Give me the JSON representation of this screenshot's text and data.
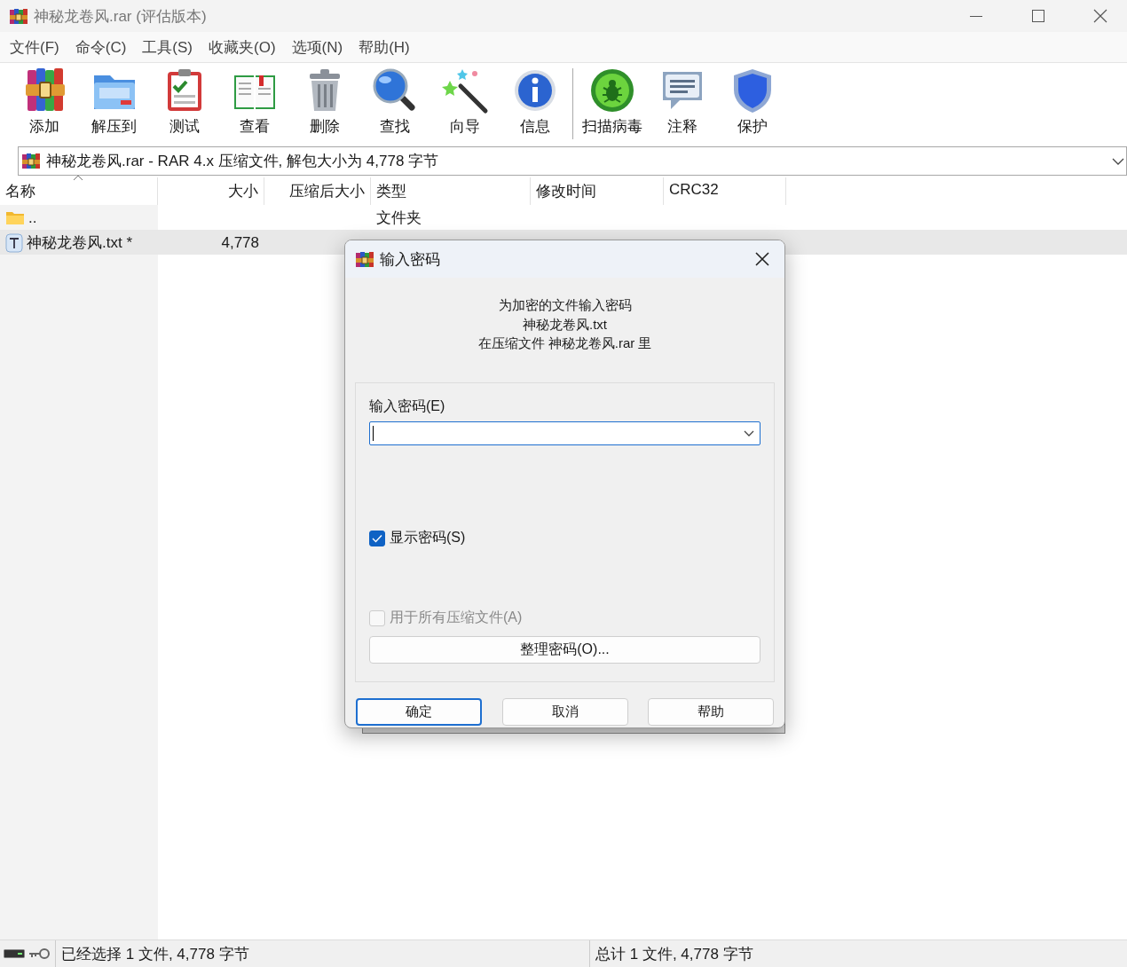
{
  "window": {
    "title": "神秘龙卷风.rar (评估版本)"
  },
  "menu": [
    "文件(F)",
    "命令(C)",
    "工具(S)",
    "收藏夹(O)",
    "选项(N)",
    "帮助(H)"
  ],
  "toolbar_groups": [
    [
      {
        "label": "添加"
      },
      {
        "label": "解压到"
      },
      {
        "label": "测试"
      },
      {
        "label": "查看"
      },
      {
        "label": "删除"
      },
      {
        "label": "查找"
      },
      {
        "label": "向导"
      },
      {
        "label": "信息"
      }
    ],
    [
      {
        "label": "扫描病毒"
      },
      {
        "label": "注释"
      },
      {
        "label": "保护"
      }
    ]
  ],
  "address": "神秘龙卷风.rar - RAR 4.x 压缩文件, 解包大小为 4,778 字节",
  "table": {
    "columns": [
      {
        "label": "名称",
        "sorted": true
      },
      {
        "label": "大小",
        "sorted": false
      },
      {
        "label": "压缩后大小",
        "sorted": false
      },
      {
        "label": "类型",
        "sorted": false
      },
      {
        "label": "修改时间",
        "sorted": false
      },
      {
        "label": "CRC32",
        "sorted": false
      }
    ],
    "rows": [
      {
        "kind": "folder",
        "selected": false,
        "name": "..",
        "type": "文件夹"
      },
      {
        "kind": "text",
        "selected": true,
        "name": "神秘龙卷风.txt *",
        "size": "4,778"
      }
    ]
  },
  "dialog": {
    "title": "输入密码",
    "message": [
      "为加密的文件输入密码",
      "神秘龙卷风.txt",
      "在压缩文件 神秘龙卷风.rar 里"
    ],
    "password": {
      "label": "输入密码(E)",
      "focused": true
    },
    "checkboxes": [
      {
        "label": "显示密码(S)",
        "checked": true,
        "disabled": false
      },
      {
        "label": "用于所有压缩文件(A)",
        "checked": false,
        "disabled": true
      }
    ],
    "organize_button": "整理密码(O)...",
    "buttons": [
      {
        "label": "确定",
        "default": true
      },
      {
        "label": "取消",
        "default": false
      },
      {
        "label": "帮助",
        "default": false
      }
    ]
  },
  "status_bar": {
    "left": "已经选择 1 文件, 4,778 字节",
    "right": "总计 1 文件, 4,778 字节"
  }
}
